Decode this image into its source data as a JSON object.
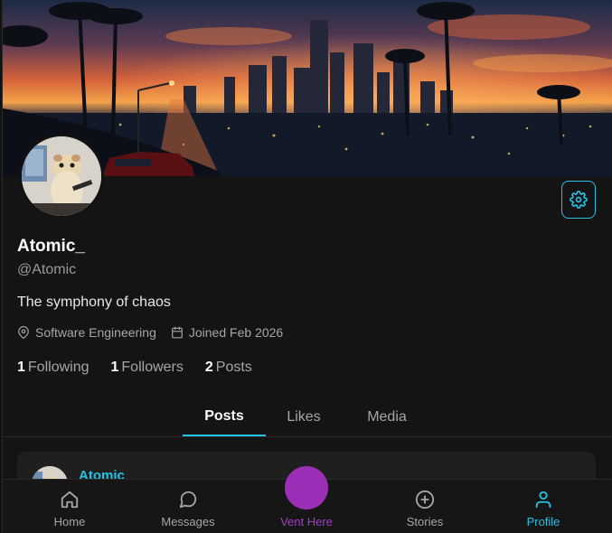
{
  "profile": {
    "display_name": "Atomic_",
    "handle": "@Atomic",
    "bio": "The symphony of chaos",
    "occupation": "Software Engineering",
    "joined": "Joined Feb 2026"
  },
  "stats": {
    "following_count": "1",
    "following_label": "Following",
    "followers_count": "1",
    "followers_label": "Followers",
    "posts_count": "2",
    "posts_label": "Posts"
  },
  "tabs": [
    {
      "label": "Posts",
      "active": true
    },
    {
      "label": "Likes",
      "active": false
    },
    {
      "label": "Media",
      "active": false
    }
  ],
  "post_preview": {
    "author": "Atomic"
  },
  "bottom_nav": [
    {
      "label": "Home",
      "icon": "home-icon"
    },
    {
      "label": "Messages",
      "icon": "message-icon"
    },
    {
      "label": "Vent Here",
      "icon": "vent-button"
    },
    {
      "label": "Stories",
      "icon": "plus-circle-icon"
    },
    {
      "label": "Profile",
      "icon": "user-icon",
      "active": true
    }
  ],
  "colors": {
    "accent": "#22c3e6",
    "vent": "#9b2fb8",
    "background": "#141414"
  }
}
